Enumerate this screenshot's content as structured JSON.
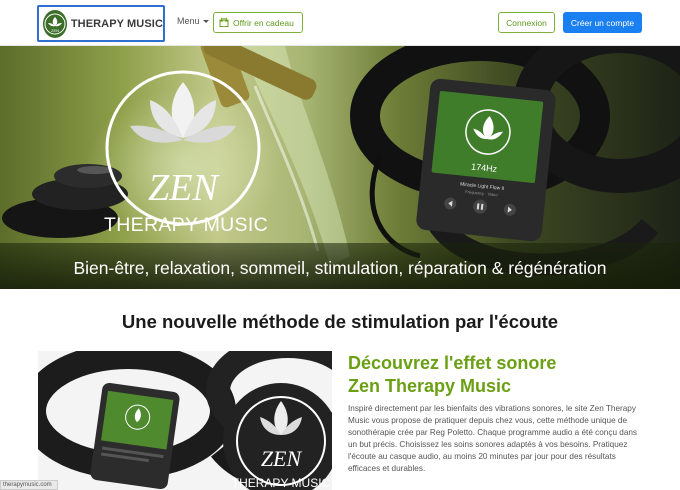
{
  "navbar": {
    "brand_label": "THERAPY MUSIC",
    "menu_label": "Menu",
    "gift_label": "Offrir en cadeau",
    "login_label": "Connexion",
    "signup_label": "Créer un compte"
  },
  "hero": {
    "logo_word": "ZEN",
    "logo_subtitle": "THERAPY MUSIC",
    "player_freq": "174Hz",
    "player_track": "Miracle Light Flow II",
    "player_artist": "Frequency · Video",
    "slogan": "Bien-être, relaxation, sommeil, stimulation, réparation & régénération"
  },
  "section": {
    "title": "Une nouvelle méthode de stimulation par l'écoute",
    "feature_heading_line1": "Découvrez l'effet sonore",
    "feature_heading_line2": "Zen Therapy Music",
    "feature_text": "Inspiré directement par les bienfaits des vibrations sonores, le site Zen Therapy Music vous propose de pratiquer depuis chez vous, cette méthode unique de sonothérapie crée par Reg Poletto. Chaque programme audio a été conçu dans un but précis. Choisissez les soins sonores adaptés à vos besoins. Pratiquez l'écoute au casque audio, au moins 20 minutes par jour pour des résultats efficaces et durables.",
    "image_logo_word": "ZEN",
    "image_logo_subtitle": "THERAPY MUSIC"
  },
  "status": {
    "url": "therapymusic.com"
  },
  "colors": {
    "accent_green": "#6ba015",
    "primary_blue": "#1a7ff0",
    "brand_border": "#2e6fd1"
  },
  "icons": [
    "lotus-logo-icon",
    "gift-icon",
    "caret-down-icon",
    "play-icon",
    "previous-icon",
    "next-icon"
  ]
}
